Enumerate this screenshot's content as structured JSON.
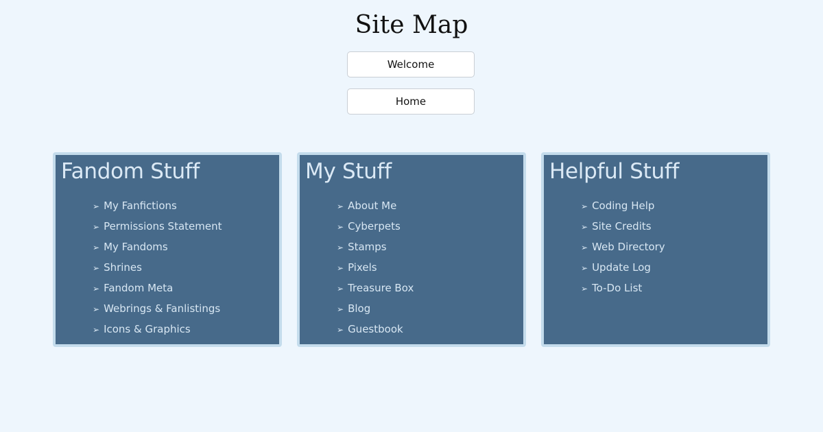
{
  "page": {
    "title": "Site Map"
  },
  "nav_buttons": {
    "welcome": "Welcome",
    "home": "Home"
  },
  "panels": [
    {
      "title": "Fandom Stuff",
      "items": [
        "My Fanfictions",
        "Permissions Statement",
        "My Fandoms",
        "Shrines",
        "Fandom Meta",
        "Webrings & Fanlistings",
        "Icons & Graphics"
      ]
    },
    {
      "title": "My Stuff",
      "items": [
        "About Me",
        "Cyberpets",
        "Stamps",
        "Pixels",
        "Treasure Box",
        "Blog",
        "Guestbook"
      ]
    },
    {
      "title": "Helpful Stuff",
      "items": [
        "Coding Help",
        "Site Credits",
        "Web Directory",
        "Update Log",
        "To-Do List"
      ]
    }
  ],
  "icons": {
    "list_bullet": "arrow-right-icon",
    "list_bullet_glyph": "➢"
  },
  "colors": {
    "background": "#eef6fd",
    "panel_fill": "#476a8a",
    "panel_border": "#c4dcec",
    "panel_text": "#d8e7f3"
  }
}
